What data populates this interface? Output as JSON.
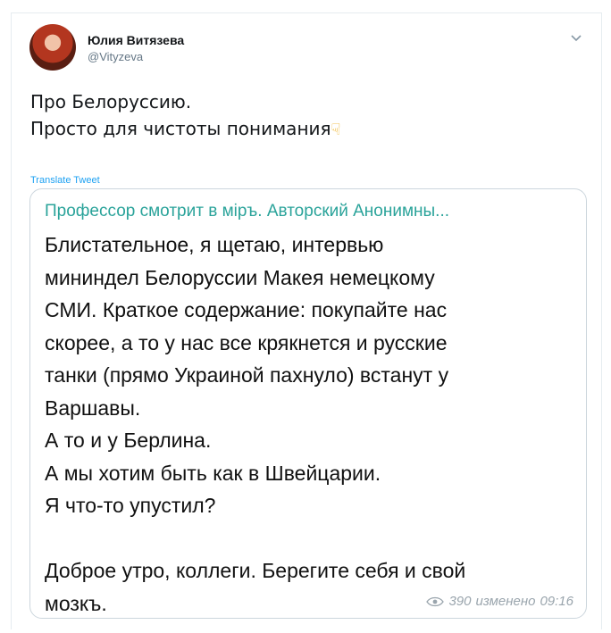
{
  "author": {
    "name": "Юлия Витязева",
    "handle": "@Vityzeva"
  },
  "tweet": {
    "lines": [
      "Про Белоруссию.",
      "Просто для чистоты понимания"
    ],
    "translate_label": "Translate Tweet"
  },
  "quoted_card": {
    "title": "Профессор смотрит в міръ. Авторский Анонимны...",
    "lines": [
      "Блистательное, я щетаю, интервью",
      "мининдел Белоруссии Макея немецкому",
      "СМИ. Краткое содержание: покупайте нас",
      "скорее, а то у нас все крякнется и русские",
      "танки (прямо Украиной пахнуло) встанут у",
      "Варшавы.",
      "А то и у Берлина.",
      "А мы хотим быть как в Швейцарии.",
      "Я что-то упустил?",
      "",
      "Доброе утро, коллеги. Берегите себя и свой",
      "мозкъ."
    ],
    "views": "390",
    "edited_label": "изменено",
    "time": "09:16"
  },
  "icons": {
    "caret": "chevron-down-icon",
    "emoji": "backhand-index-pointing-down",
    "views": "eye-icon"
  },
  "colors": {
    "link": "#1da1f2",
    "card_title": "#2aa39a",
    "meta": "#9aa5ad"
  }
}
